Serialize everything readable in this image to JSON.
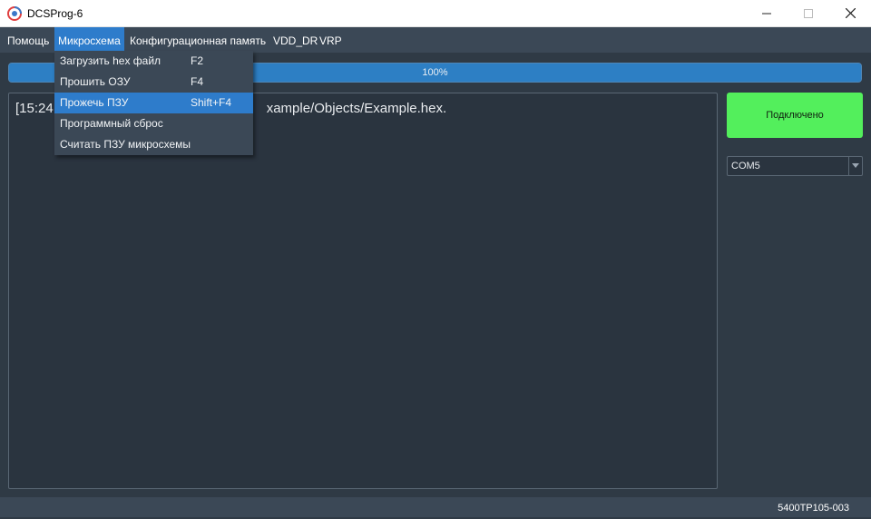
{
  "window": {
    "title": "DCSProg-6",
    "app_icon": "dcsprog-logo-icon",
    "controls": [
      "minimize-icon",
      "maximize-icon",
      "close-icon"
    ]
  },
  "menubar": {
    "items": [
      {
        "label": "Помощь"
      },
      {
        "label": "Микросхема",
        "active": true
      },
      {
        "label": "Конфигурационная память"
      },
      {
        "label": "VDD_DR"
      },
      {
        "label": "VRP"
      }
    ]
  },
  "dropdown": {
    "items": [
      {
        "label": "Загрузить hex файл",
        "shortcut": "F2"
      },
      {
        "label": "Прошить ОЗУ",
        "shortcut": "F4"
      },
      {
        "label": "Прожечь ПЗУ",
        "shortcut": "Shift+F4",
        "highlighted": true
      },
      {
        "label": "Программный сброс",
        "shortcut": ""
      },
      {
        "label": "Считать ПЗУ микросхемы",
        "shortcut": ""
      }
    ]
  },
  "progress": {
    "text": "100%",
    "value": 1.0
  },
  "log": {
    "visible_prefix": "[15:24",
    "visible_suffix": "xample/Objects/Example.hex."
  },
  "connection": {
    "button_label": "Подключено",
    "button_color": "#53ef5c",
    "port_value": "COM5"
  },
  "status": {
    "text": "5400ТР105-003"
  },
  "colors": {
    "background": "#2f3a45",
    "menubar": "#3b4856",
    "accent": "#2e7ccb"
  }
}
